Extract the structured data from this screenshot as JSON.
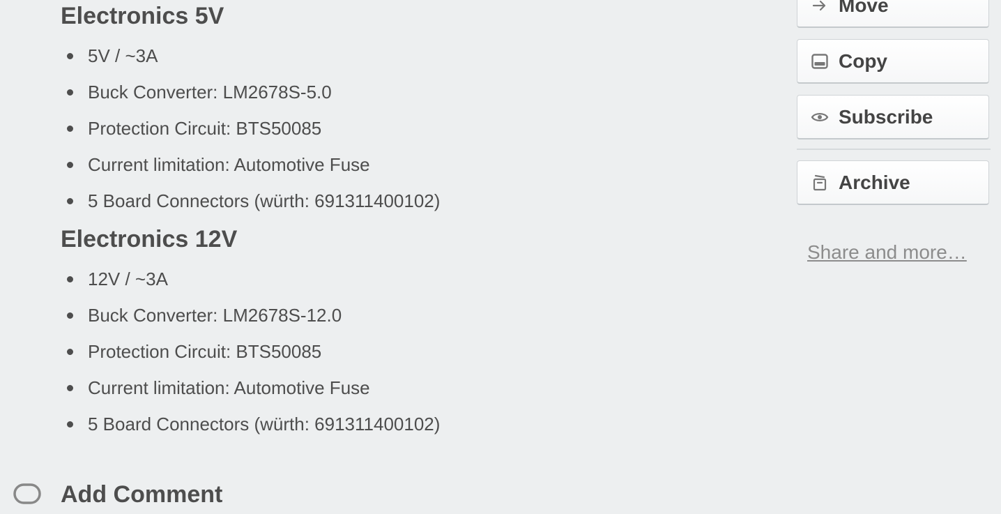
{
  "description": {
    "sections": [
      {
        "heading": "Electronics 5V",
        "items": [
          "5V / ~3A",
          "Buck Converter: LM2678S-5.0",
          "Protection Circuit: BTS50085",
          "Current limitation: Automotive Fuse",
          "5 Board Connectors (würth: 691311400102)"
        ]
      },
      {
        "heading": "Electronics 12V",
        "items": [
          "12V / ~3A",
          "Buck Converter: LM2678S-12.0",
          "Protection Circuit: BTS50085",
          "Current limitation: Automotive Fuse",
          "5 Board Connectors (würth: 691311400102)"
        ]
      }
    ]
  },
  "sidebar": {
    "actions": [
      {
        "label": "Move",
        "icon": "arrow-right-icon"
      },
      {
        "label": "Copy",
        "icon": "copy-icon"
      },
      {
        "label": "Subscribe",
        "icon": "eye-icon"
      },
      {
        "label": "Archive",
        "icon": "archive-icon"
      }
    ],
    "share_link": "Share and more…"
  },
  "comment": {
    "title": "Add Comment",
    "icon": "comment-icon"
  },
  "colors": {
    "background": "#edeff0",
    "text": "#4d4d4d",
    "link": "#8c8c8c"
  }
}
